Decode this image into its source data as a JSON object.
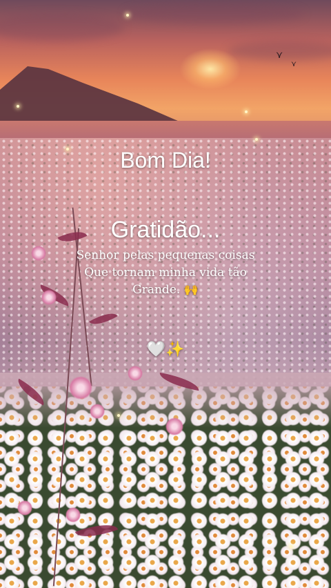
{
  "text": {
    "greeting": "Bom Dia!",
    "heading": "Gratidão...",
    "line1": "Senhor pelas pequenas coisas",
    "line2": "Que tornam minha vida tão",
    "line3": "Grande. 🙌",
    "emoji_row": "🤍✨"
  },
  "palette": {
    "sky_top": "#6f4a5c",
    "sunset": "#e8855a",
    "field_pink": "#c98c93",
    "daisy_white": "#f6eef2",
    "daisy_center": "#e9a74a"
  }
}
